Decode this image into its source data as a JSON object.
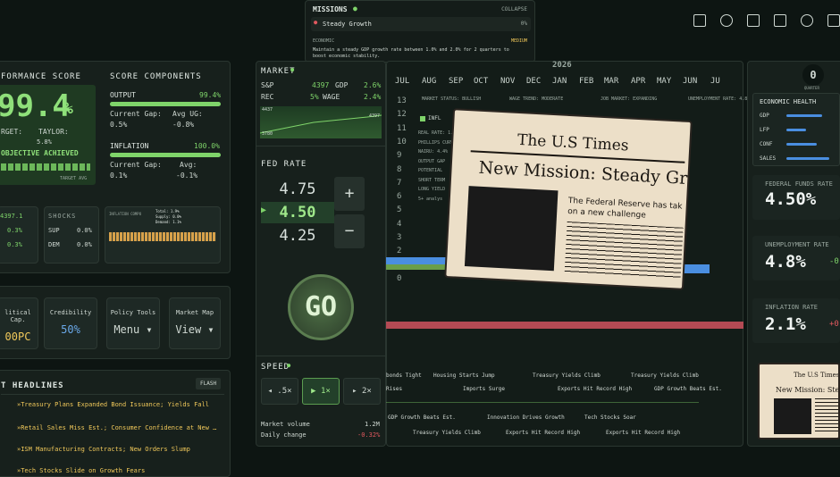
{
  "missions": {
    "title": "MISSIONS",
    "collapse": "COLLAPSE",
    "item": "Steady Growth",
    "item_pct": "0%",
    "category": "ECONOMIC",
    "difficulty": "MEDIUM",
    "desc1": "Maintain a steady GDP growth rate between 1.0% and 2.0% for 2 quarters to",
    "desc2": "boost economic stability."
  },
  "score": {
    "title": "FORMANCE SCORE",
    "value": "99.4",
    "pct": "%",
    "target": "RGET:",
    "taylor": "TAYLOR:",
    "taylor_val": "5.8%",
    "achieved": "OBJECTIVE ACHIEVED",
    "target_avg": "TARGET AVG"
  },
  "components": {
    "title": "SCORE COMPONENTS",
    "output": "OUTPUT",
    "output_val": "99.4%",
    "output_gap": "Current Gap:",
    "output_gap_val": "0.5%",
    "output_avg": "Avg UG:",
    "output_avg_val": "-0.8%",
    "inflation": "INFLATION",
    "inflation_val": "100.0%",
    "infl_gap": "Current Gap:",
    "infl_gap_val": "0.1%",
    "infl_avg": "Avg:",
    "infl_avg_val": "-0.1%"
  },
  "mini": {
    "v1": "4397.1",
    "v2": "0.3%",
    "v3": "0.3%",
    "shocks": "SHOCKS",
    "sup": "SUP",
    "sup_val": "0.0%",
    "dem": "DEM",
    "dem_val": "0.0%",
    "infl_comp": "INFLATION COMPO",
    "total": "Total: 1.9%",
    "supply": "Supply: 0.0%",
    "demand": "Demand: 1.1%"
  },
  "tiles": [
    {
      "label": "litical Cap.",
      "value": "00PC"
    },
    {
      "label": "Credibility",
      "value": "50%"
    },
    {
      "label": "Policy Tools",
      "value": "Menu ▾"
    },
    {
      "label": "Market Map",
      "value": "View ▾"
    }
  ],
  "headlines": {
    "title": "T HEADLINES",
    "flash": "FLASH",
    "items": [
      "»Treasury Plans Expanded Bond Issuance; Yields Fall",
      "»Retail Sales Miss Est.; Consumer Confidence at New …",
      "»ISM Manufacturing Contracts; New Orders Slump",
      "»Tech Stocks Slide on Growth Fears"
    ]
  },
  "market": {
    "title": "MARKET",
    "sp": "S&P",
    "sp_val": "4397",
    "gdp": "GDP",
    "gdp_val": "2.6%",
    "rec": "REC",
    "rec_val": "5%",
    "wage": "WAGE",
    "wage_val": "2.4%",
    "hi": "4437",
    "lo": "3780",
    "last": "4397"
  },
  "fed": {
    "title": "FED RATE",
    "up": "4.75",
    "current": "4.50",
    "down": "4.25",
    "plus": "+",
    "minus": "−",
    "go": "GO"
  },
  "speed": {
    "title": "SPEED",
    "s1": ".5×",
    "s2": "1×",
    "s3": "2×",
    "volume": "Market volume",
    "volume_val": "1.2M",
    "change": "Daily change",
    "change_val": "-0.32%"
  },
  "timeline": {
    "year": "2026",
    "months": [
      "JUL",
      "AUG",
      "SEP",
      "OCT",
      "NOV",
      "DEC",
      "JAN",
      "FEB",
      "MAR",
      "APR",
      "MAY",
      "JUN",
      "JU"
    ],
    "ticks": [
      "13",
      "12",
      "11",
      "10",
      "9",
      "8",
      "7",
      "6",
      "5",
      "4",
      "3",
      "2",
      "1",
      "0"
    ],
    "status": "MARKET STATUS: BULLISH",
    "wage": "WAGE TREND: MODERATE",
    "job": "JOB MARKET: EXPANDING",
    "unemp": "UNEMPLOYMENT RATE: 4.8",
    "infl": "INFL",
    "side_labels": [
      "REAL RATE: 1.9%",
      "PHILLIPS CURVE",
      "NAIRU: 4.4%",
      "OUTPUT GAP",
      "POTENTIAL",
      "SHORT TERM",
      "LONG YIELD",
      "5+ analys"
    ],
    "events": [
      "Housing Starts Jump",
      "Imports Surge",
      "Treasury Yields Climb",
      "Exports Hit Record High",
      "Treasury Yields Climb",
      "GDP Growth Beats Est.",
      "Innovation Drives Growth",
      "Tech Stocks Soar",
      "Treasury Yields Climb",
      "Exports Hit Record High",
      "Exports Hit Record High",
      "GDP Growth Beats Est.",
      "bonds Tight",
      "Rises"
    ]
  },
  "newspaper": {
    "paper": "The U.S Times",
    "headline": "New Mission: Steady Gro",
    "sub": "The Federal Reserve has tak",
    "sub2": "on a new challenge"
  },
  "quarter": {
    "value": "0",
    "label": "QUARTER"
  },
  "health": {
    "title": "ECONOMIC HEALTH",
    "rows": [
      "GDP",
      "LFP",
      "CONF",
      "SALES"
    ]
  },
  "stats": [
    {
      "label": "FEDERAL FUNDS RATE",
      "value": "4.50%"
    },
    {
      "label": "UNEMPLOYMENT RATE",
      "value": "4.8%",
      "delta": "-0"
    },
    {
      "label": "INFLATION RATE",
      "value": "2.1%",
      "delta": "+0"
    }
  ],
  "mini_paper": {
    "paper": "The U.S Times",
    "headline": "New Mission: Stea"
  },
  "colors": {
    "accent": "#7fd46a",
    "red": "#e0585e",
    "blue": "#4a8ee0"
  }
}
